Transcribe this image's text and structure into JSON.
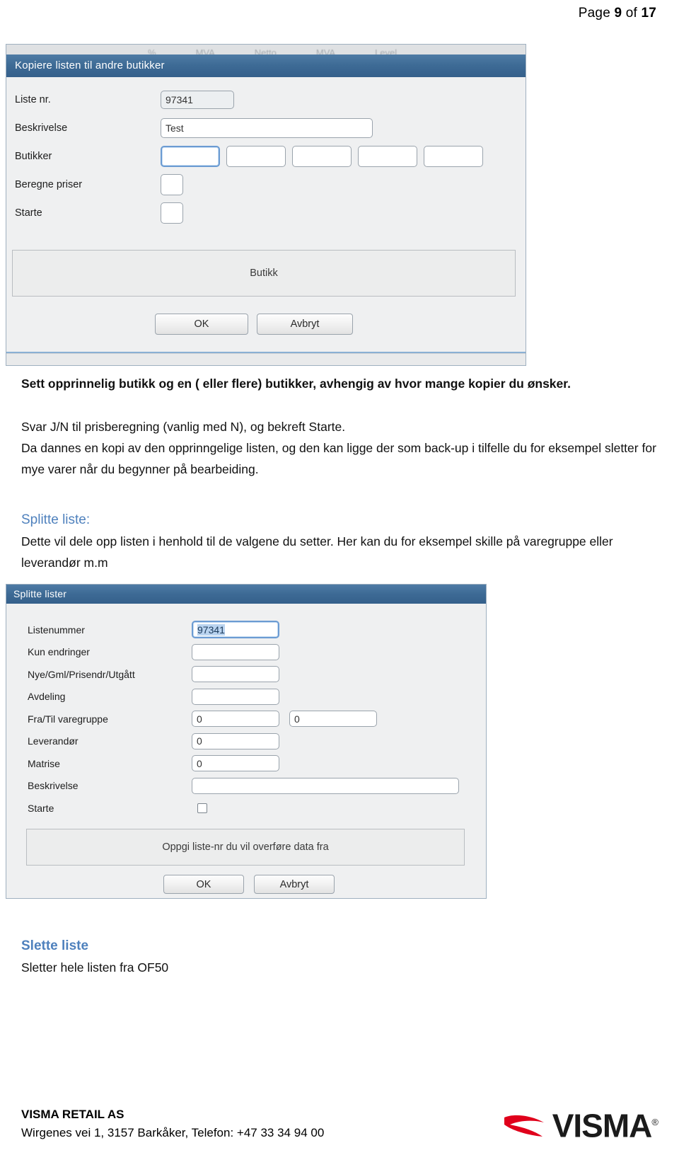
{
  "header": {
    "prefix": "Page ",
    "current": "9",
    "mid": " of ",
    "total": "17"
  },
  "dialog1": {
    "title": "Kopiere listen til andre butikker",
    "ghost_columns": [
      "%",
      "MVA",
      "Netto",
      "MVA",
      "Level"
    ],
    "labels": [
      "Liste nr.",
      "Beskrivelse",
      "Butikker",
      "Beregne priser",
      "Starte"
    ],
    "liste_nr_value": "97341",
    "beskrivelse_value": "Test",
    "butikker_values": [
      "",
      "",
      "",
      "",
      ""
    ],
    "beregne_priser_value": "",
    "starte_value": "",
    "panel_label": "Butikk",
    "ok_label": "OK",
    "cancel_label": "Avbryt"
  },
  "body": {
    "para1": "Sett opprinnelig butikk og en ( eller flere) butikker, avhengig av hvor mange kopier du ønsker.",
    "para2": "Svar J/N til prisberegning (vanlig med N), og bekreft Starte.",
    "para3": "Da dannes en kopi av den opprinngelige listen, og den kan ligge der som back-up i tilfelle du for eksempel sletter for mye varer når du begynner på bearbeiding.",
    "heading_split": "Splitte liste:",
    "para4": "Dette vil dele opp listen i henhold til de valgene du setter. Her kan du for eksempel skille på varegruppe eller leverandør m.m",
    "heading_delete": "Slette liste",
    "para5": "Sletter hele listen fra OF50"
  },
  "dialog2": {
    "title": "Splitte lister",
    "labels": [
      "Listenummer",
      "Kun endringer",
      "Nye/Gml/Prisendr/Utgått",
      "Avdeling",
      "Fra/Til varegruppe",
      "Leverandør",
      "Matrise",
      "Beskrivelse",
      "Starte"
    ],
    "listenummer_value": "97341",
    "kun_endringer_value": "",
    "nye_gml_value": "",
    "avdeling_value": "",
    "fra_varegruppe_value": "0",
    "til_varegruppe_value": "0",
    "leverandor_value": "0",
    "matrise_value": "0",
    "beskrivelse_value": "",
    "info_panel": "Oppgi liste-nr du vil overføre data fra",
    "ok_label": "OK",
    "cancel_label": "Avbryt"
  },
  "footer": {
    "company": "VISMA RETAIL AS",
    "address": "Wirgenes vei 1, 3157 Barkåker, Telefon: +47 33 34 94 00",
    "logo_word": "VISMA",
    "logo_reg": "®"
  },
  "colors": {
    "accent_blue": "#4f81bd",
    "titlebar_blue": "#3d6a95",
    "visma_red": "#e0001b"
  }
}
